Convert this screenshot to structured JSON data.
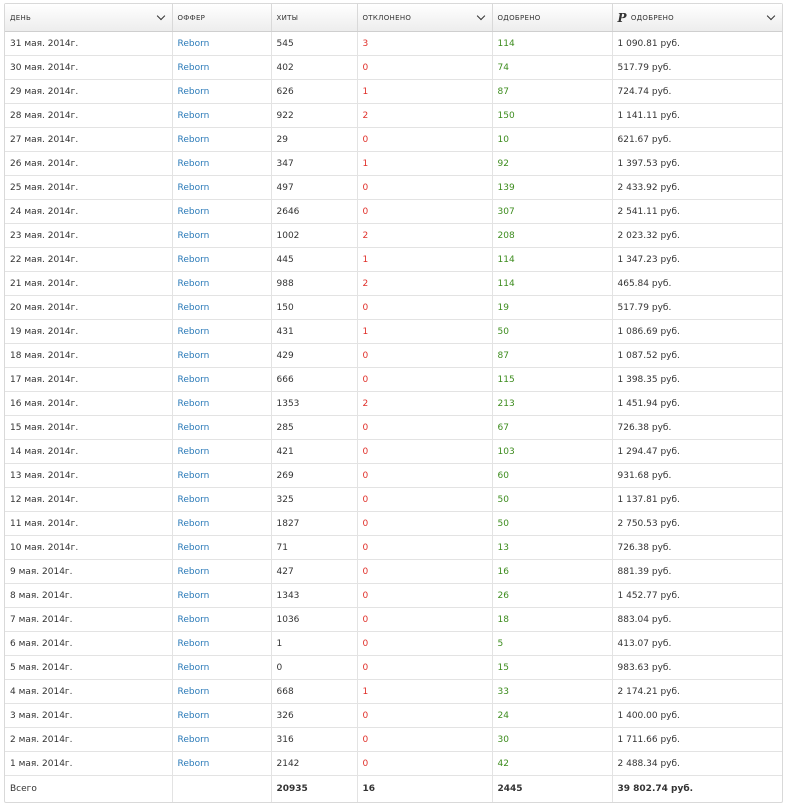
{
  "columns": [
    {
      "key": "day",
      "label": "день",
      "sortable": true
    },
    {
      "key": "offer",
      "label": "оффер",
      "sortable": false
    },
    {
      "key": "hits",
      "label": "хиты",
      "sortable": false
    },
    {
      "key": "rejected",
      "label": "отклонено",
      "sortable": true
    },
    {
      "key": "approved",
      "label": "одобрено",
      "sortable": false
    },
    {
      "key": "approved_sum",
      "label": "одобрено",
      "sortable": true,
      "icon": "ruble-icon"
    }
  ],
  "rows": [
    {
      "day": "31 мая. 2014г.",
      "offer": "Reborn",
      "hits": "545",
      "rejected": "3",
      "approved": "114",
      "approved_sum": "1 090.81 руб."
    },
    {
      "day": "30 мая. 2014г.",
      "offer": "Reborn",
      "hits": "402",
      "rejected": "0",
      "approved": "74",
      "approved_sum": "517.79 руб."
    },
    {
      "day": "29 мая. 2014г.",
      "offer": "Reborn",
      "hits": "626",
      "rejected": "1",
      "approved": "87",
      "approved_sum": "724.74 руб."
    },
    {
      "day": "28 мая. 2014г.",
      "offer": "Reborn",
      "hits": "922",
      "rejected": "2",
      "approved": "150",
      "approved_sum": "1 141.11 руб."
    },
    {
      "day": "27 мая. 2014г.",
      "offer": "Reborn",
      "hits": "29",
      "rejected": "0",
      "approved": "10",
      "approved_sum": "621.67 руб."
    },
    {
      "day": "26 мая. 2014г.",
      "offer": "Reborn",
      "hits": "347",
      "rejected": "1",
      "approved": "92",
      "approved_sum": "1 397.53 руб."
    },
    {
      "day": "25 мая. 2014г.",
      "offer": "Reborn",
      "hits": "497",
      "rejected": "0",
      "approved": "139",
      "approved_sum": "2 433.92 руб."
    },
    {
      "day": "24 мая. 2014г.",
      "offer": "Reborn",
      "hits": "2646",
      "rejected": "0",
      "approved": "307",
      "approved_sum": "2 541.11 руб."
    },
    {
      "day": "23 мая. 2014г.",
      "offer": "Reborn",
      "hits": "1002",
      "rejected": "2",
      "approved": "208",
      "approved_sum": "2 023.32 руб."
    },
    {
      "day": "22 мая. 2014г.",
      "offer": "Reborn",
      "hits": "445",
      "rejected": "1",
      "approved": "114",
      "approved_sum": "1 347.23 руб."
    },
    {
      "day": "21 мая. 2014г.",
      "offer": "Reborn",
      "hits": "988",
      "rejected": "2",
      "approved": "114",
      "approved_sum": "465.84 руб."
    },
    {
      "day": "20 мая. 2014г.",
      "offer": "Reborn",
      "hits": "150",
      "rejected": "0",
      "approved": "19",
      "approved_sum": "517.79 руб."
    },
    {
      "day": "19 мая. 2014г.",
      "offer": "Reborn",
      "hits": "431",
      "rejected": "1",
      "approved": "50",
      "approved_sum": "1 086.69 руб."
    },
    {
      "day": "18 мая. 2014г.",
      "offer": "Reborn",
      "hits": "429",
      "rejected": "0",
      "approved": "87",
      "approved_sum": "1 087.52 руб."
    },
    {
      "day": "17 мая. 2014г.",
      "offer": "Reborn",
      "hits": "666",
      "rejected": "0",
      "approved": "115",
      "approved_sum": "1 398.35 руб."
    },
    {
      "day": "16 мая. 2014г.",
      "offer": "Reborn",
      "hits": "1353",
      "rejected": "2",
      "approved": "213",
      "approved_sum": "1 451.94 руб."
    },
    {
      "day": "15 мая. 2014г.",
      "offer": "Reborn",
      "hits": "285",
      "rejected": "0",
      "approved": "67",
      "approved_sum": "726.38 руб."
    },
    {
      "day": "14 мая. 2014г.",
      "offer": "Reborn",
      "hits": "421",
      "rejected": "0",
      "approved": "103",
      "approved_sum": "1 294.47 руб."
    },
    {
      "day": "13 мая. 2014г.",
      "offer": "Reborn",
      "hits": "269",
      "rejected": "0",
      "approved": "60",
      "approved_sum": "931.68 руб."
    },
    {
      "day": "12 мая. 2014г.",
      "offer": "Reborn",
      "hits": "325",
      "rejected": "0",
      "approved": "50",
      "approved_sum": "1 137.81 руб."
    },
    {
      "day": "11 мая. 2014г.",
      "offer": "Reborn",
      "hits": "1827",
      "rejected": "0",
      "approved": "50",
      "approved_sum": "2 750.53 руб."
    },
    {
      "day": "10 мая. 2014г.",
      "offer": "Reborn",
      "hits": "71",
      "rejected": "0",
      "approved": "13",
      "approved_sum": "726.38 руб."
    },
    {
      "day": "9 мая. 2014г.",
      "offer": "Reborn",
      "hits": "427",
      "rejected": "0",
      "approved": "16",
      "approved_sum": "881.39 руб."
    },
    {
      "day": "8 мая. 2014г.",
      "offer": "Reborn",
      "hits": "1343",
      "rejected": "0",
      "approved": "26",
      "approved_sum": "1 452.77 руб."
    },
    {
      "day": "7 мая. 2014г.",
      "offer": "Reborn",
      "hits": "1036",
      "rejected": "0",
      "approved": "18",
      "approved_sum": "883.04 руб."
    },
    {
      "day": "6 мая. 2014г.",
      "offer": "Reborn",
      "hits": "1",
      "rejected": "0",
      "approved": "5",
      "approved_sum": "413.07 руб."
    },
    {
      "day": "5 мая. 2014г.",
      "offer": "Reborn",
      "hits": "0",
      "rejected": "0",
      "approved": "15",
      "approved_sum": "983.63 руб."
    },
    {
      "day": "4 мая. 2014г.",
      "offer": "Reborn",
      "hits": "668",
      "rejected": "1",
      "approved": "33",
      "approved_sum": "2 174.21 руб."
    },
    {
      "day": "3 мая. 2014г.",
      "offer": "Reborn",
      "hits": "326",
      "rejected": "0",
      "approved": "24",
      "approved_sum": "1 400.00 руб."
    },
    {
      "day": "2 мая. 2014г.",
      "offer": "Reborn",
      "hits": "316",
      "rejected": "0",
      "approved": "30",
      "approved_sum": "1 711.66 руб."
    },
    {
      "day": "1 мая. 2014г.",
      "offer": "Reborn",
      "hits": "2142",
      "rejected": "0",
      "approved": "42",
      "approved_sum": "2 488.34 руб."
    }
  ],
  "totals": {
    "label": "Всего",
    "offer": "",
    "hits": "20935",
    "rejected": "16",
    "approved": "2445",
    "approved_sum": "39 802.74 руб."
  },
  "colors": {
    "link": "#2a7ab8",
    "rejected": "#e0302a",
    "approved": "#3d8c1e"
  }
}
